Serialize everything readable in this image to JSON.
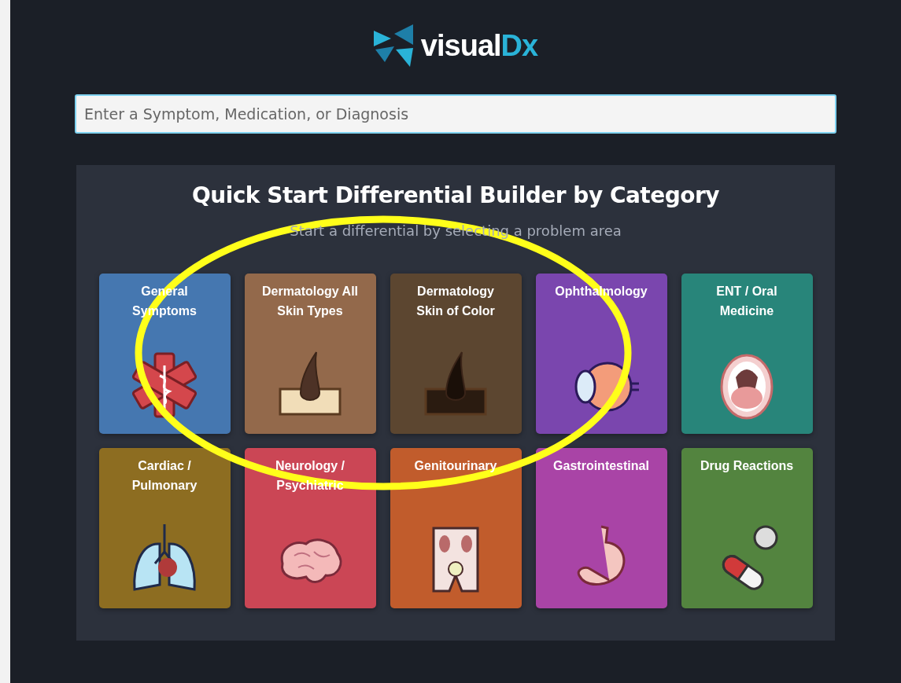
{
  "logo": {
    "text": "visual",
    "accent": "Dx"
  },
  "search": {
    "placeholder": "Enter a Symptom, Medication, or Diagnosis"
  },
  "panel": {
    "title": "Quick Start Differential Builder by Category",
    "subtitle": "Start a differential by selecting a problem area"
  },
  "categories": [
    {
      "label": "General\nSymptoms",
      "color": "#4577b0",
      "kind": "medical"
    },
    {
      "label": "Dermatology All\nSkin Types",
      "color": "#93694b",
      "kind": "skinlight"
    },
    {
      "label": "Dermatology\nSkin of Color",
      "color": "#5c4630",
      "kind": "skindark"
    },
    {
      "label": "Ophthalmology",
      "color": "#7a46ae",
      "kind": "eye"
    },
    {
      "label": "ENT / Oral\nMedicine",
      "color": "#28857a",
      "kind": "mouth"
    },
    {
      "label": "Cardiac /\nPulmonary",
      "color": "#8d6d21",
      "kind": "lungs"
    },
    {
      "label": "Neurology /\nPsychiatric",
      "color": "#cb4655",
      "kind": "brain"
    },
    {
      "label": "Genitourinary",
      "color": "#c15c2c",
      "kind": "kidney"
    },
    {
      "label": "Gastrointestinal",
      "color": "#a944a6",
      "kind": "stomach"
    },
    {
      "label": "Drug Reactions",
      "color": "#53843f",
      "kind": "pills"
    }
  ],
  "annotation": {
    "kind": "ellipse"
  }
}
